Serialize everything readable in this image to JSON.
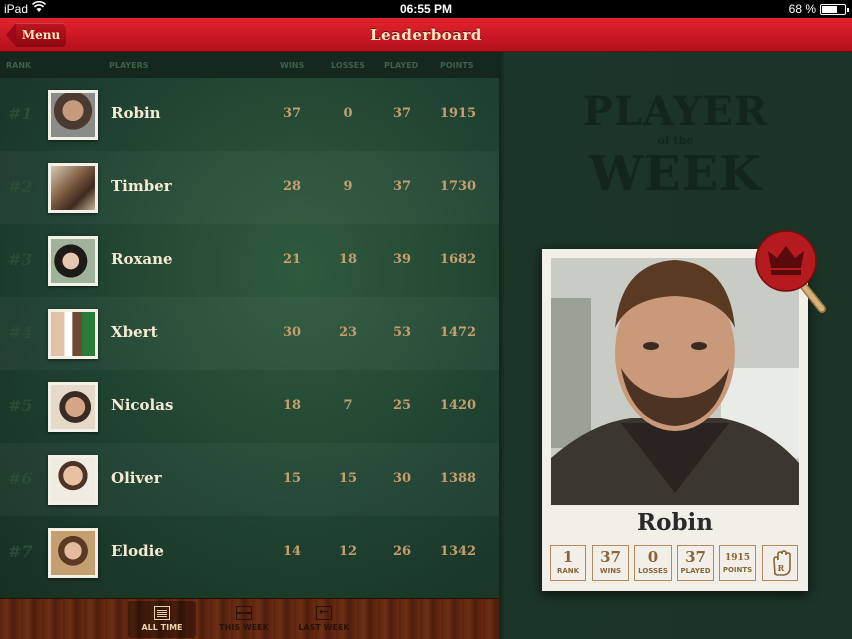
{
  "status_bar": {
    "device": "iPad",
    "time": "06:55 PM",
    "battery": "68 %",
    "battery_level": 0.68
  },
  "nav": {
    "title": "Leaderboard",
    "menu_label": "Menu"
  },
  "columns": {
    "rank": "RANK",
    "players": "PLAYERS",
    "wins": "WINS",
    "losses": "LOSSES",
    "played": "PLAYED",
    "points": "POINTS"
  },
  "players": [
    {
      "rank": "#1",
      "name": "Robin",
      "wins": "37",
      "losses": "0",
      "played": "37",
      "points": "1915"
    },
    {
      "rank": "#2",
      "name": "Timber",
      "wins": "28",
      "losses": "9",
      "played": "37",
      "points": "1730"
    },
    {
      "rank": "#3",
      "name": "Roxane",
      "wins": "21",
      "losses": "18",
      "played": "39",
      "points": "1682"
    },
    {
      "rank": "#4",
      "name": "Xbert",
      "wins": "30",
      "losses": "23",
      "played": "53",
      "points": "1472"
    },
    {
      "rank": "#5",
      "name": "Nicolas",
      "wins": "18",
      "losses": "7",
      "played": "25",
      "points": "1420"
    },
    {
      "rank": "#6",
      "name": "Oliver",
      "wins": "15",
      "losses": "15",
      "played": "30",
      "points": "1388"
    },
    {
      "rank": "#7",
      "name": "Elodie",
      "wins": "14",
      "losses": "12",
      "played": "26",
      "points": "1342"
    }
  ],
  "toolbar": {
    "all_time": "ALL TIME",
    "this_week": "THIS WEEK",
    "last_week": "LAST WEEK",
    "selected": "all_time"
  },
  "player_of_week": {
    "heading_line1": "PLAYER",
    "heading_line2": "of the",
    "heading_line3": "WEEK",
    "name": "Robin",
    "rank": "1",
    "rank_label": "RANK",
    "wins": "37",
    "wins_label": "WINS",
    "losses": "0",
    "losses_label": "LOSSES",
    "played": "37",
    "played_label": "PLAYED",
    "points": "1915",
    "points_label": "POINTS"
  },
  "icons": {
    "wifi": "wifi-icon",
    "battery": "battery-icon",
    "all_time": "list-icon",
    "this_week": "calendar-icon",
    "last_week": "back-icon",
    "paddle": "crown-paddle-icon",
    "hand": "hand-icon"
  },
  "colors": {
    "nav_red": "#c8141f",
    "felt_green": "#1f4130",
    "name_cream": "#f5ead4",
    "stat_tan": "#c69f6f",
    "wood": "#5a2410"
  }
}
